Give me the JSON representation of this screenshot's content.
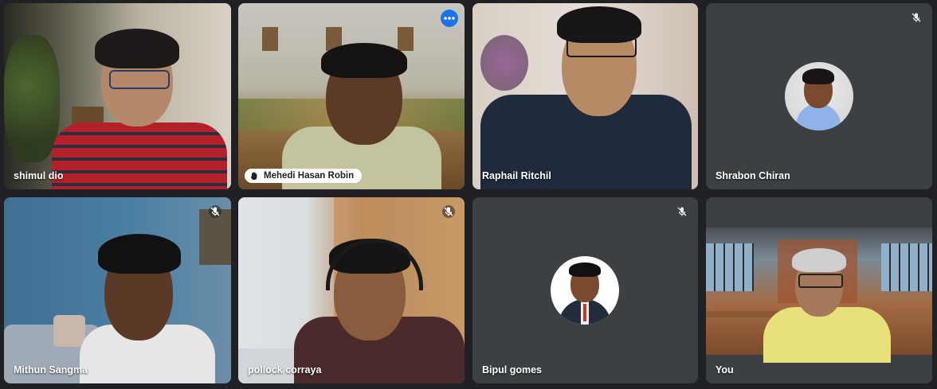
{
  "app": {
    "name": "Video meeting grid"
  },
  "colors": {
    "background": "#202124",
    "tile_bg": "#3c4043",
    "active_speaker_border": "#8ab4f8",
    "accent": "#1a73e8",
    "label_text": "#ffffff"
  },
  "participants": [
    {
      "name": "shimul dio",
      "muted": false,
      "video": "on",
      "icon": "none"
    },
    {
      "name": "Mehedi Hasan Robin",
      "muted": false,
      "video": "on",
      "active_speaker": true,
      "hand_raised": true,
      "icon": "raised-hand-icon",
      "menu_icon": "more-options-icon"
    },
    {
      "name": "Raphail Ritchil",
      "muted": false,
      "video": "on",
      "icon": "none"
    },
    {
      "name": "Shrabon Chiran",
      "muted": true,
      "video": "off",
      "icon": "mic-off-icon"
    },
    {
      "name": "Mithun Sangma",
      "muted": true,
      "video": "on",
      "icon": "mic-off-icon"
    },
    {
      "name": "pollock corraya",
      "muted": true,
      "video": "on",
      "icon": "mic-off-icon"
    },
    {
      "name": "Bipul gomes",
      "muted": true,
      "video": "off",
      "icon": "mic-off-icon"
    },
    {
      "name": "You",
      "muted": false,
      "video": "on",
      "icon": "none"
    }
  ]
}
